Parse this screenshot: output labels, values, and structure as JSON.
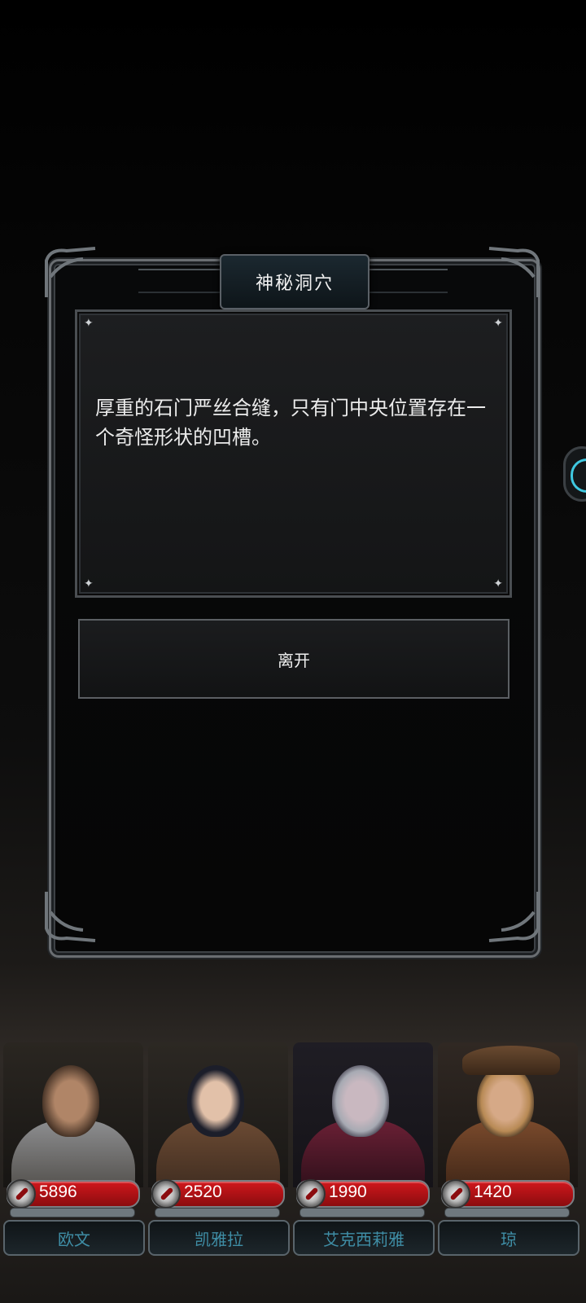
{
  "dialog": {
    "title": "神秘洞穴",
    "text": "厚重的石门严丝合缝，只有门中央位置存在一个奇怪形状的凹槽。",
    "button_label": "离开"
  },
  "party": [
    {
      "name": "欧文",
      "hp": "5896"
    },
    {
      "name": "凯雅拉",
      "hp": "2520"
    },
    {
      "name": "艾克西莉雅",
      "hp": "1990"
    },
    {
      "name": "琼",
      "hp": "1420"
    }
  ],
  "colors": {
    "hp_bar": "#c4141a",
    "name_text": "#3f8ea6",
    "side_tab_accent": "#3fc8e0"
  }
}
